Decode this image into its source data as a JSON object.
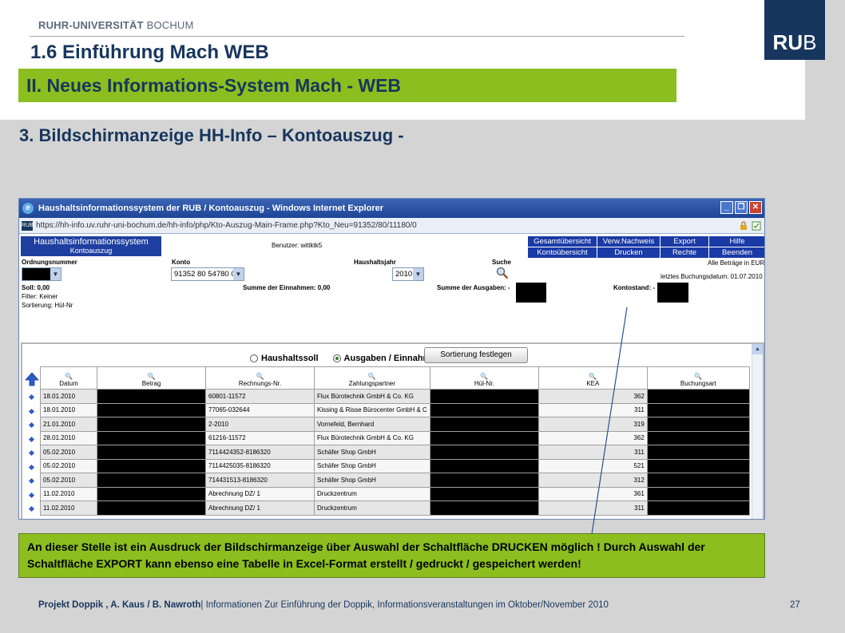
{
  "slide": {
    "university_bold": "RUHR-UNIVERSITÄT",
    "university_light": "BOCHUM",
    "logo_bold": "RU",
    "logo_light": "B",
    "title": "1.6 Einführung Mach WEB",
    "section_title": "II. Neues Informations-System Mach - WEB",
    "subtitle": "3. Bildschirmanzeige HH-Info – Kontoauszug -",
    "note": "An dieser Stelle  ist ein Ausdruck der Bildschirmanzeige über Auswahl der Schaltfläche DRUCKEN möglich ! Durch Auswahl der Schaltfläche EXPORT kann ebenso eine Tabelle in  Excel-Format erstellt / gedruckt / gespeichert werden!",
    "footer_bold": "Projekt Doppik , A. Kaus / B. Nawroth",
    "footer_text": "| Informationen Zur Einführung der Doppik, Informationsveranstaltungen im Oktober/November 2010",
    "page_number": "27"
  },
  "browser": {
    "window_title": "Haushaltsinformationssystem der RUB / Kontoauszug - Windows Internet Explorer",
    "favicon": "RUB",
    "url": "https://hh-info.uv.ruhr-uni-bochum.de/hh-info/php/Kto-Auszug-Main-Frame.php?Kto_Neu=91352/80/11180/0"
  },
  "app": {
    "header_line1": "Haushaltsinformationssystem",
    "header_line2": "Kontoauszug",
    "user_label": "Benutzer: wittktk5",
    "nav_row1": [
      "Gesamtübersicht",
      "Verw.Nachweis",
      "Export",
      "Hilfe"
    ],
    "nav_row2": [
      "Kontoübersicht",
      "Drucken",
      "Rechte",
      "Beenden"
    ],
    "amounts_note": "Alle Beträge in EUR",
    "last_booking": "letztes Buchungsdatum: 01.07.2010",
    "ordnung_label": "Ordnungsnummer",
    "konto_label": "Konto",
    "konto_value": "91352 80 54780 0",
    "haushaltsjahr_label": "Haushaltsjahr",
    "haushaltsjahr_value": "2010",
    "suche_label": "Suche",
    "soll": "Soll: 0,00",
    "filter": "Filter: Keiner",
    "sortierung": "Sortierung: Hül-Nr",
    "einnahmen": "Summe der Einnahmen: 0,00",
    "ausgaben": "Summe der Ausgaben: -",
    "kontostand": "Kontostand: -",
    "radio_haushaltssoll": "Haushaltssoll",
    "radio_ausgaben": "Ausgaben / Einnahmen",
    "sort_button": "Sortierung festlegen",
    "columns": [
      "Datum",
      "Betrag",
      "Rechnungs-Nr.",
      "Zahlungspartner",
      "Hül-Nr.",
      "KEA",
      "Buchungsart"
    ],
    "rows": [
      {
        "datum": "18.01.2010",
        "rechnung": "60801-11572",
        "partner": "Flux Bürotechnik GmbH & Co. KG",
        "kea": "362"
      },
      {
        "datum": "18.01.2010",
        "rechnung": "77065-032644",
        "partner": "Kissing & Risse Bürocenter GmbH & C",
        "kea": "311"
      },
      {
        "datum": "21.01.2010",
        "rechnung": "2-2010",
        "partner": "Vornefeld, Bernhard",
        "kea": "319"
      },
      {
        "datum": "28.01.2010",
        "rechnung": "61216-11572",
        "partner": "Flux Bürotechnik GmbH & Co. KG",
        "kea": "362"
      },
      {
        "datum": "05.02.2010",
        "rechnung": "7114424352-8186320",
        "partner": "Schäfer Shop GmbH",
        "kea": "311"
      },
      {
        "datum": "05.02.2010",
        "rechnung": "7114425035-8186320",
        "partner": "Schäfer Shop GmbH",
        "kea": "521"
      },
      {
        "datum": "05.02.2010",
        "rechnung": "714431513-8186320",
        "partner": "Schäfer Shop GmbH",
        "kea": "312"
      },
      {
        "datum": "11.02.2010",
        "rechnung": "Abrechnung DZ/ 1",
        "partner": "Druckzentrum",
        "kea": "361"
      },
      {
        "datum": "11.02.2010",
        "rechnung": "Abrechnung DZ/ 1",
        "partner": "Druckzentrum",
        "kea": "311"
      }
    ]
  }
}
